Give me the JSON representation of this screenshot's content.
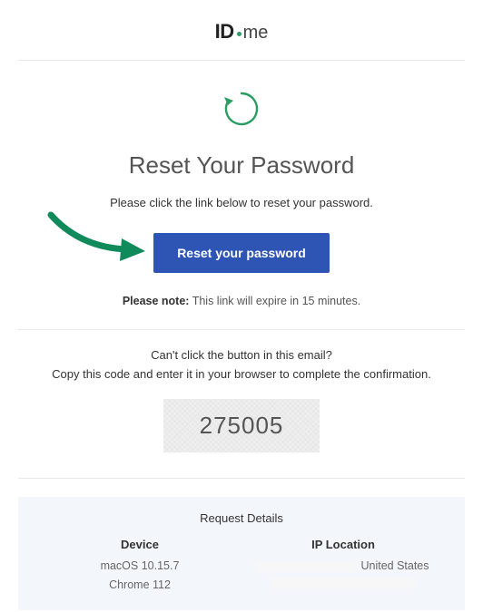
{
  "logo": {
    "id": "ID",
    "me": "me"
  },
  "main": {
    "title": "Reset Your Password",
    "subtitle": "Please click the link below to reset your password.",
    "button_label": "Reset your password",
    "note_label": "Please note:",
    "note_text": " This link will expire in 15 minutes."
  },
  "fallback": {
    "line1": "Can't click the button in this email?",
    "line2": "Copy this code and enter it in your browser to complete the confirmation.",
    "code": "275005"
  },
  "details": {
    "title": "Request Details",
    "device_header": "Device",
    "device_os": "macOS 10.15.7",
    "device_browser": "Chrome 112",
    "ip_header": "IP Location",
    "ip_country": "United States"
  }
}
